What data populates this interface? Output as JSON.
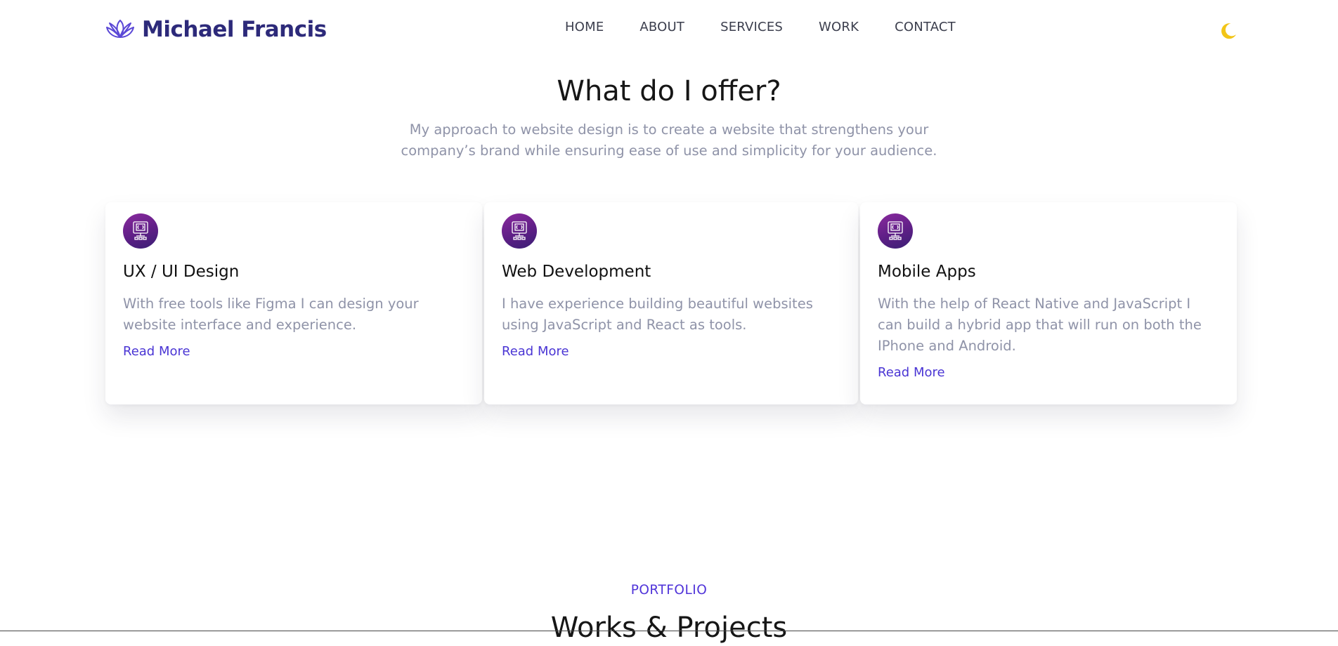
{
  "header": {
    "brand_name": "Michael Francis",
    "logo_icon": "lotus-icon",
    "nav": [
      "HOME",
      "ABOUT",
      "SERVICES",
      "WORK",
      "CONTACT"
    ],
    "theme_toggle_icon": "moon-icon"
  },
  "services": {
    "title": "What do I offer?",
    "description": "My approach to website design is to create a website that strengthens your company’s brand while ensuring ease of use and simplicity for your audience.",
    "cards": [
      {
        "icon": "monitor-icon",
        "title": "UX / UI Design",
        "text": "With free tools like Figma I can design your website interface and experience.",
        "link": "Read More"
      },
      {
        "icon": "monitor-icon",
        "title": "Web Development",
        "text": "I have experience building beautiful websites using JavaScript and React as tools.",
        "link": "Read More"
      },
      {
        "icon": "monitor-icon",
        "title": "Mobile Apps",
        "text": "With the help of React Native and JavaScript I can build a hybrid app that will run on both the IPhone and Android.",
        "link": "Read More"
      }
    ]
  },
  "portfolio": {
    "eyebrow": "PORTFOLIO",
    "title": "Works & Projects"
  },
  "colors": {
    "brand": "#2d2a7a",
    "accent": "#4a35d4",
    "icon_gradient_start": "#8a2a9e",
    "icon_gradient_end": "#3a1f74",
    "moon": "#f2c518",
    "muted_text": "#8f93a8"
  }
}
